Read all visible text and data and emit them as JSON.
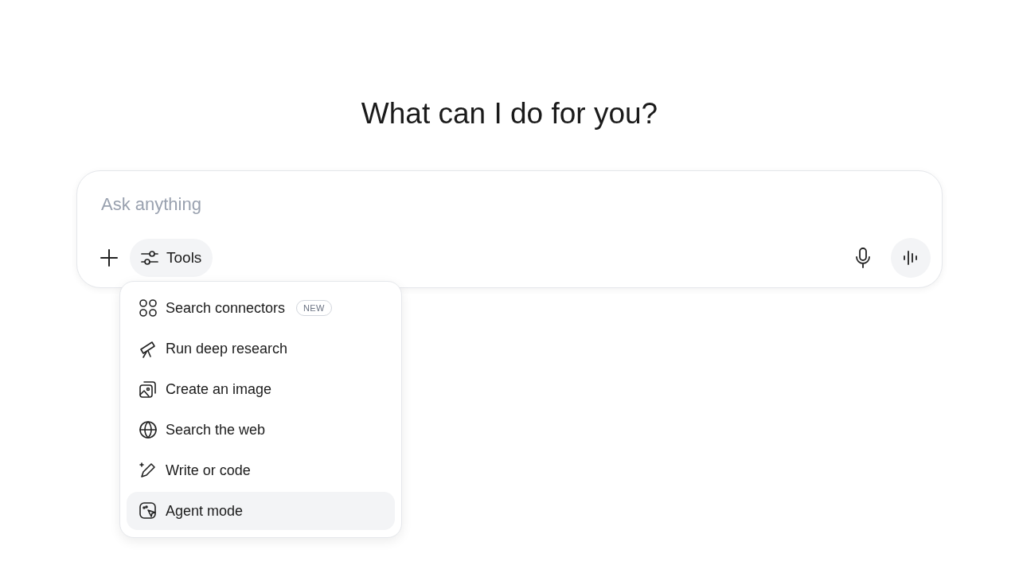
{
  "heading": "What can I do for you?",
  "composer": {
    "placeholder": "Ask anything",
    "tools_button": "Tools"
  },
  "tools_menu": [
    {
      "label": "Search connectors",
      "badge": "NEW",
      "selected": false
    },
    {
      "label": "Run deep research",
      "selected": false
    },
    {
      "label": "Create an image",
      "selected": false
    },
    {
      "label": "Search the web",
      "selected": false
    },
    {
      "label": "Write or code",
      "selected": false
    },
    {
      "label": "Agent mode",
      "selected": true
    }
  ]
}
